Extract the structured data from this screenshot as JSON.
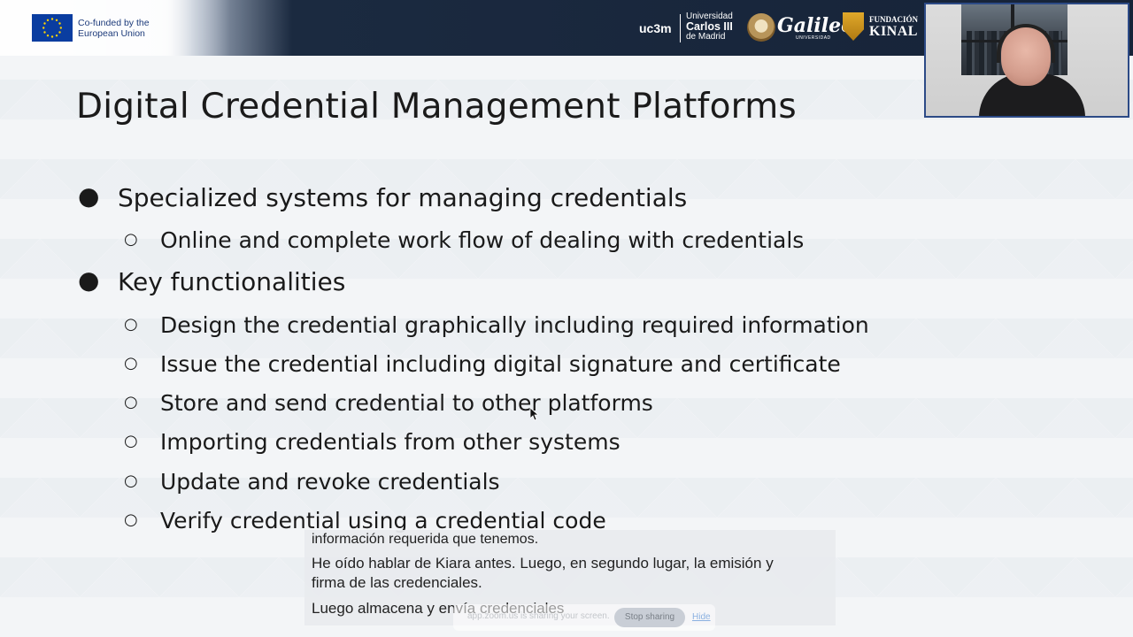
{
  "header": {
    "eu_label": "Co-funded by the European Union",
    "uc3m_short": "uc3m",
    "ucm_line1": "Universidad",
    "ucm_line2": "Carlos III",
    "ucm_line3": "de Madrid",
    "galileo_name": "Galileo",
    "galileo_sub": "UNIVERSIDAD",
    "kinal_line1": "FUNDACIÓN",
    "kinal_line2": "KINAL"
  },
  "slide": {
    "title": "Digital Credential Management Platforms",
    "bullets": [
      {
        "text": "Specialized systems for managing credentials",
        "sub": [
          "Online and complete work flow of dealing with credentials"
        ]
      },
      {
        "text": "Key functionalities",
        "sub": [
          "Design the credential graphically including required information",
          "Issue the credential including digital signature and certificate",
          "Store and send credential to other platforms",
          "Importing credentials from other systems",
          "Update and revoke credentials",
          "Verify credential using a credential code"
        ]
      }
    ]
  },
  "captions": {
    "line1": "información requerida que tenemos.",
    "line2": "He oído hablar de Kiara antes. Luego, en segundo lugar, la emisión y firma de las credenciales.",
    "line3": "Luego almacena y envía credenciales"
  },
  "share_bar": {
    "message": "app.zoom.us is sharing your screen.",
    "stop_label": "Stop sharing",
    "hide_label": "Hide"
  },
  "colors": {
    "header_dark": "#162338",
    "eu_blue": "#0a3da0",
    "webcam_border": "#2c4a86"
  }
}
